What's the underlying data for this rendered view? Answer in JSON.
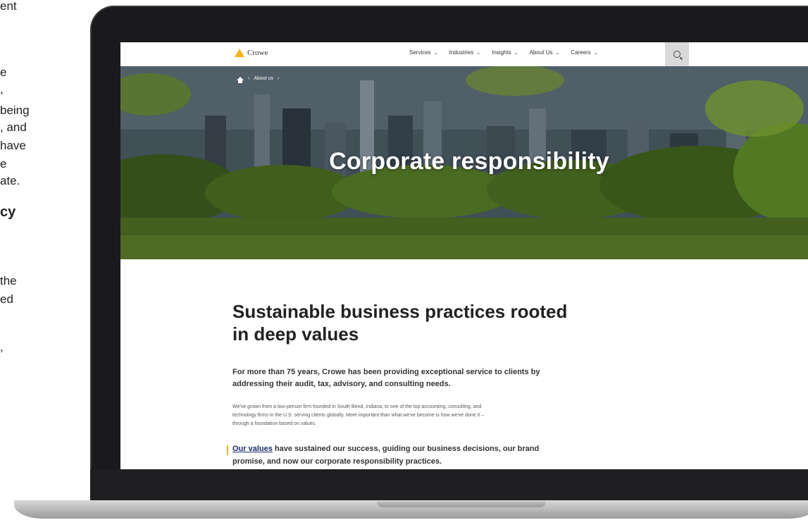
{
  "left_article": {
    "lines": [
      "ent",
      "e",
      ",",
      "being",
      ", and",
      "have",
      "e",
      "ate.",
      "cy",
      "the",
      "ed",
      ","
    ]
  },
  "site": {
    "logo_text": "Crowe",
    "accent_color": "#f5b21b",
    "nav": [
      {
        "label": "Services"
      },
      {
        "label": "Industries"
      },
      {
        "label": "Insights"
      },
      {
        "label": "About Us"
      },
      {
        "label": "Careers"
      }
    ],
    "breadcrumb": [
      "About us"
    ],
    "hero_title": "Corporate responsibility"
  },
  "content": {
    "heading_line1": "Sustainable business practices rooted",
    "heading_line2": "in deep values",
    "lead_line1": "For more than 75 years, Crowe has been providing exceptional service to clients by",
    "lead_line2": "addressing their audit, tax, advisory, and consulting needs.",
    "body_line1": "We've grown from a two-person firm founded in South Bend, Indiana, to one of the top accounting, consulting, and",
    "body_line2": "technology firms in the U.S. serving clients globally. More important than what we've become is how we've done it –",
    "body_line3": "through a foundation based on values.",
    "values_link": "Our values",
    "values_rest_line1": " have sustained our success, guiding our business decisions, our brand",
    "values_line2": "promise, and now our corporate responsibility practices."
  }
}
